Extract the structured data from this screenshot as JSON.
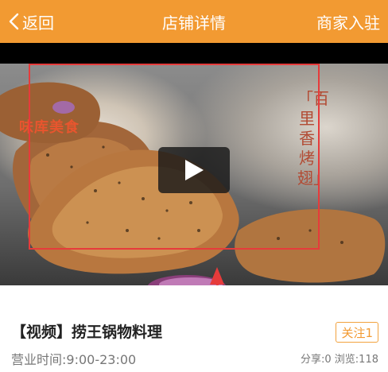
{
  "header": {
    "back_label": "返回",
    "title": "店铺详情",
    "merchant_label": "商家入驻",
    "bg_color": "#f29a32"
  },
  "video": {
    "brand": "味库美食",
    "dish_title": "「百里香烤翅」",
    "play_icon": "play-icon"
  },
  "shop": {
    "name": "【视频】捞王锅物料理",
    "follow_label": "关注1",
    "hours": "营业时间:9:00-23:00",
    "stats": "分享:0 浏览:118"
  }
}
